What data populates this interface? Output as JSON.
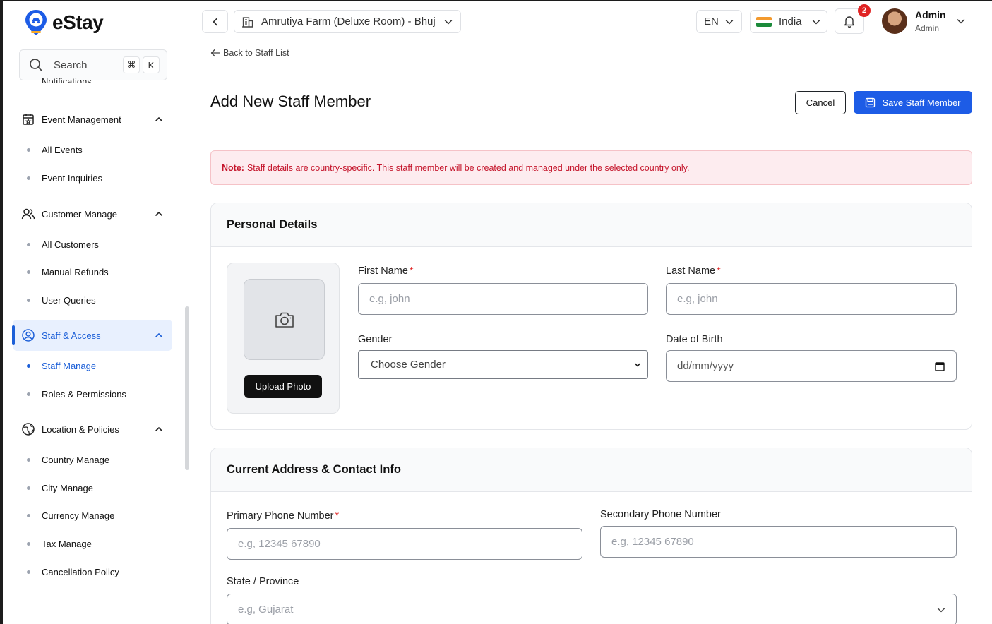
{
  "app": {
    "brand": "eStay"
  },
  "search": {
    "label": "Search",
    "kbd_cmd": "⌘",
    "kbd_key": "K"
  },
  "sidebar": {
    "cut_item": "Notifications",
    "groups": [
      {
        "label": "Event Management",
        "items": [
          "All Events",
          "Event Inquiries"
        ]
      },
      {
        "label": "Customer Manage",
        "items": [
          "All Customers",
          "Manual Refunds",
          "User Queries"
        ]
      },
      {
        "label": "Staff & Access",
        "items": [
          "Staff Manage",
          "Roles & Permissions"
        ]
      },
      {
        "label": "Location & Policies",
        "items": [
          "Country Manage",
          "City Manage",
          "Currency Manage",
          "Tax Manage",
          "Cancellation Policy"
        ]
      }
    ]
  },
  "header": {
    "property": "Amrutiya Farm (Deluxe Room) - Bhuj",
    "language": "EN",
    "country": "India",
    "notification_count": "2",
    "user_name": "Admin",
    "user_role": "Admin"
  },
  "page": {
    "back_link": "Back to Staff List",
    "title": "Add New Staff Member",
    "cancel": "Cancel",
    "save": "Save Staff Member",
    "note_label": "Note:",
    "note_text": "Staff details are country-specific. This staff member will be created and managed under the selected country only."
  },
  "personal": {
    "title": "Personal Details",
    "upload": "Upload Photo",
    "first_name_label": "First Name",
    "first_name_placeholder": "e.g, john",
    "last_name_label": "Last Name",
    "last_name_placeholder": "e.g, john",
    "gender_label": "Gender",
    "gender_value": "Choose Gender",
    "dob_label": "Date of Birth",
    "dob_placeholder": "dd/mm/yyyy",
    "required_mark": "*"
  },
  "address": {
    "title": "Current Address & Contact Info",
    "primary_label": "Primary Phone Number",
    "primary_placeholder": "e.g, 12345 67890",
    "secondary_label": "Secondary Phone Number",
    "secondary_placeholder": "e.g, 12345 67890",
    "state_label": "State / Province",
    "state_placeholder": "e.g, Gujarat"
  },
  "colors": {
    "accent": "#1d5ce6",
    "note_text": "#c5162c",
    "note_bg": "#fdecef",
    "badge": "#e02424"
  }
}
